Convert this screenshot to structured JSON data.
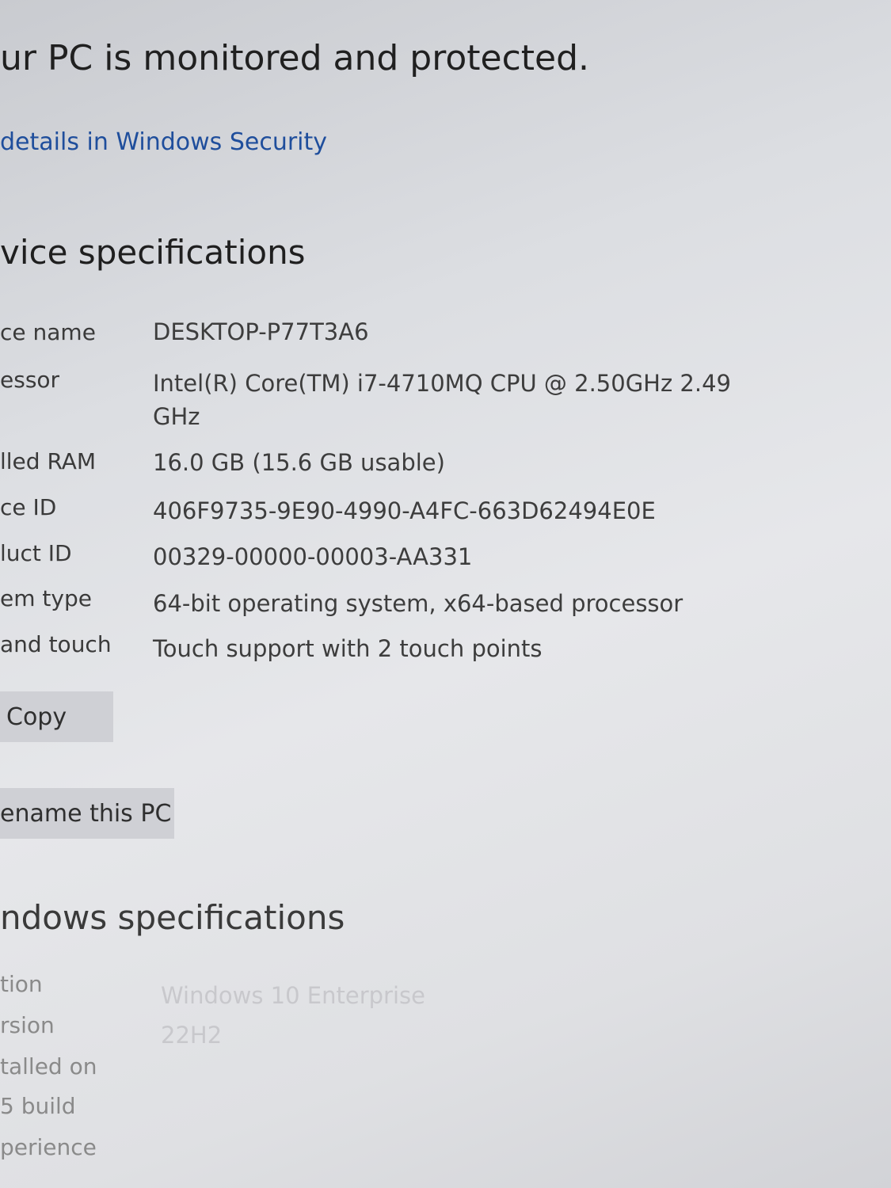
{
  "status": {
    "title": "ur PC is monitored and protected.",
    "link": "details in Windows Security"
  },
  "device_specs": {
    "title": "vice specifications",
    "rows": [
      {
        "label": "ce name",
        "value": "DESKTOP-P77T3A6"
      },
      {
        "label": "essor",
        "value": "Intel(R) Core(TM) i7-4710MQ CPU @ 2.50GHz   2.49 GHz"
      },
      {
        "label": "lled RAM",
        "value": "16.0 GB (15.6 GB usable)"
      },
      {
        "label": "ce ID",
        "value": "406F9735-9E90-4990-A4FC-663D62494E0E"
      },
      {
        "label": "luct ID",
        "value": "00329-00000-00003-AA331"
      },
      {
        "label": "em type",
        "value": "64-bit operating system, x64-based processor"
      },
      {
        "label": "and touch",
        "value": "Touch support with 2 touch points"
      }
    ],
    "copy_label": "Copy",
    "rename_label": "ename this PC"
  },
  "windows_specs": {
    "title": "ndows specifications",
    "rows": [
      {
        "label": "tion",
        "value": "Windows 10 Enterprise"
      },
      {
        "label": "rsion",
        "value": "22H2"
      },
      {
        "label": "talled on",
        "value": ""
      },
      {
        "label": "5 build",
        "value": ""
      },
      {
        "label": "perience",
        "value": ""
      }
    ]
  }
}
